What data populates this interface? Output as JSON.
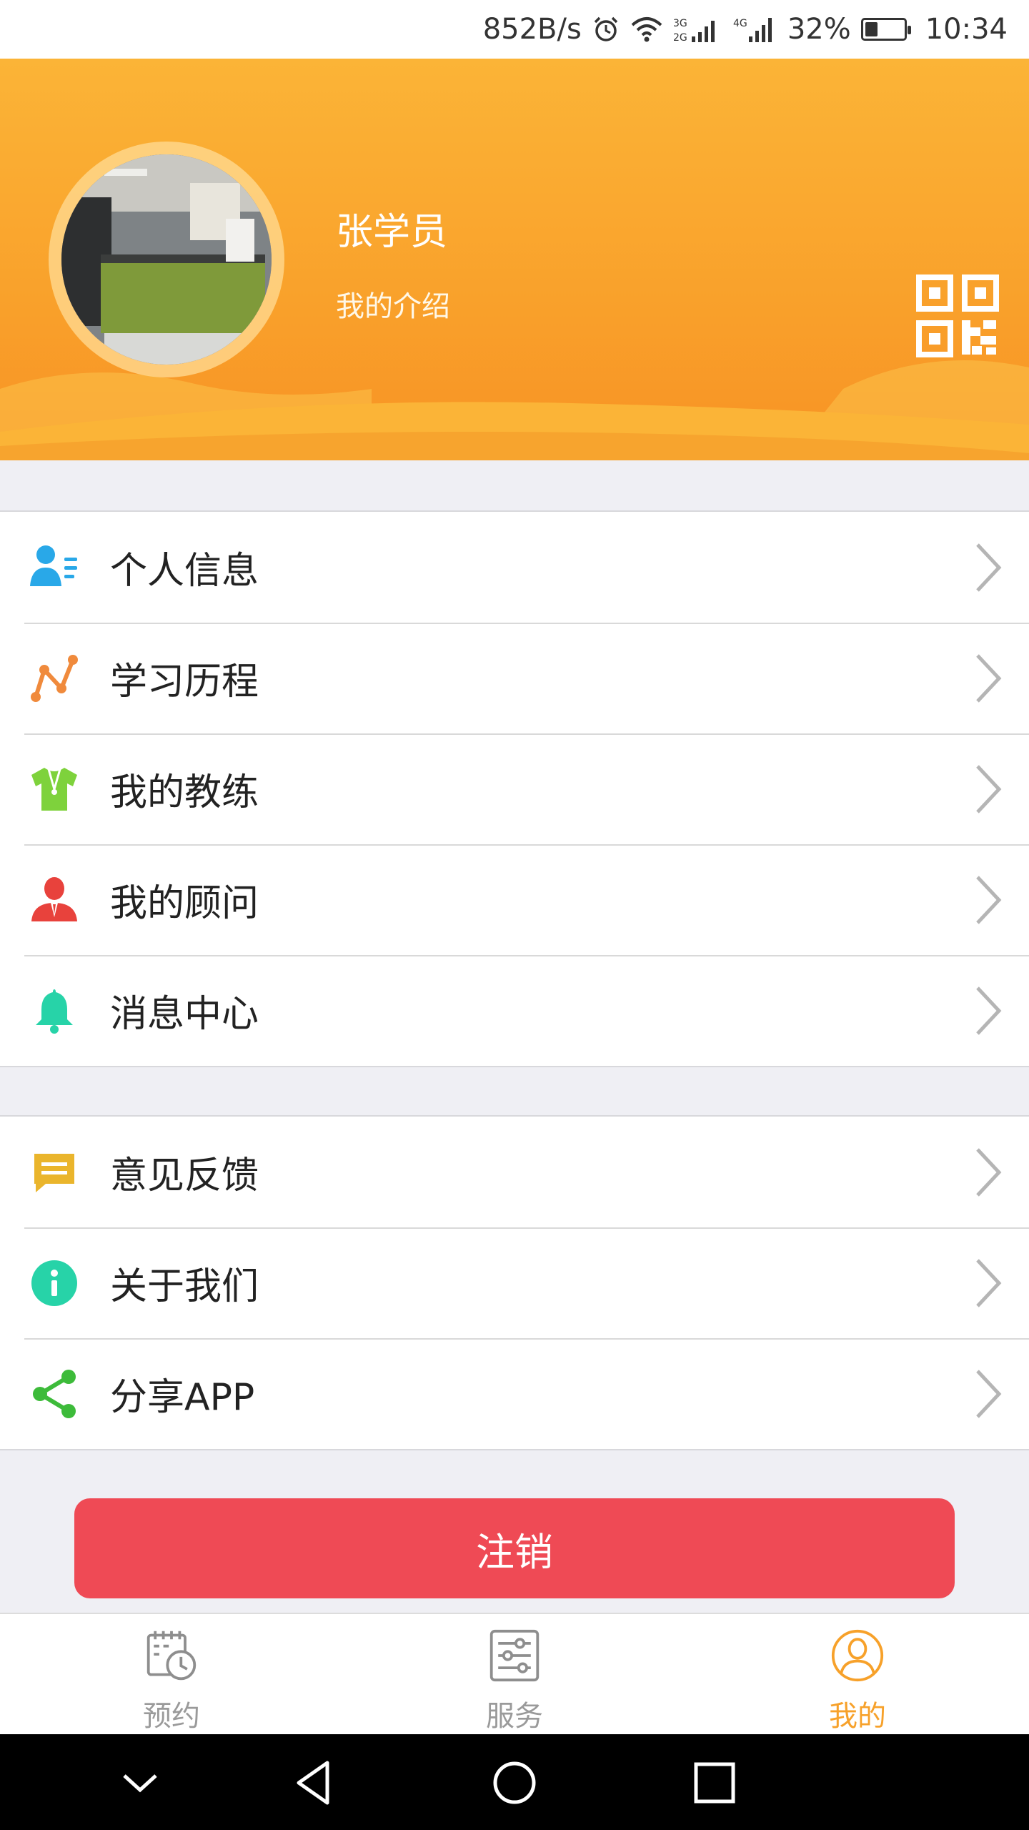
{
  "status_bar": {
    "net_speed": "852B/s",
    "battery_percent": "32%",
    "battery_level": 0.32,
    "time": "10:34",
    "icons": [
      "alarm-icon",
      "wifi-icon",
      "signal-3g-icon",
      "signal-4g-icon",
      "battery-icon"
    ]
  },
  "profile": {
    "name": "张学员",
    "intro": "我的介绍",
    "qr_icon": "qr-code-icon"
  },
  "menu_group_1": [
    {
      "label": "个人信息",
      "icon": "person-info-icon",
      "color": "#29a8e8"
    },
    {
      "label": "学习历程",
      "icon": "progress-line-icon",
      "color": "#f08a3c"
    },
    {
      "label": "我的教练",
      "icon": "coach-shirt-icon",
      "color": "#7ed23c"
    },
    {
      "label": "我的顾问",
      "icon": "advisor-icon",
      "color": "#e8423c"
    },
    {
      "label": "消息中心",
      "icon": "bell-icon",
      "color": "#27d3a8"
    }
  ],
  "menu_group_2": [
    {
      "label": "意见反馈",
      "icon": "feedback-icon",
      "color": "#eab52c"
    },
    {
      "label": "关于我们",
      "icon": "info-icon",
      "color": "#27d3a8"
    },
    {
      "label": "分享APP",
      "icon": "share-icon",
      "color": "#3dbb3a"
    }
  ],
  "logout_label": "注销",
  "tabs": [
    {
      "label": "预约",
      "icon": "calendar-clock-icon",
      "active": false
    },
    {
      "label": "服务",
      "icon": "sliders-icon",
      "active": false
    },
    {
      "label": "我的",
      "icon": "user-circle-icon",
      "active": true
    }
  ],
  "colors": {
    "accent": "#f7a12a",
    "logout": "#ef4a55",
    "header_top": "#fbb437",
    "header_bottom": "#f89224"
  }
}
